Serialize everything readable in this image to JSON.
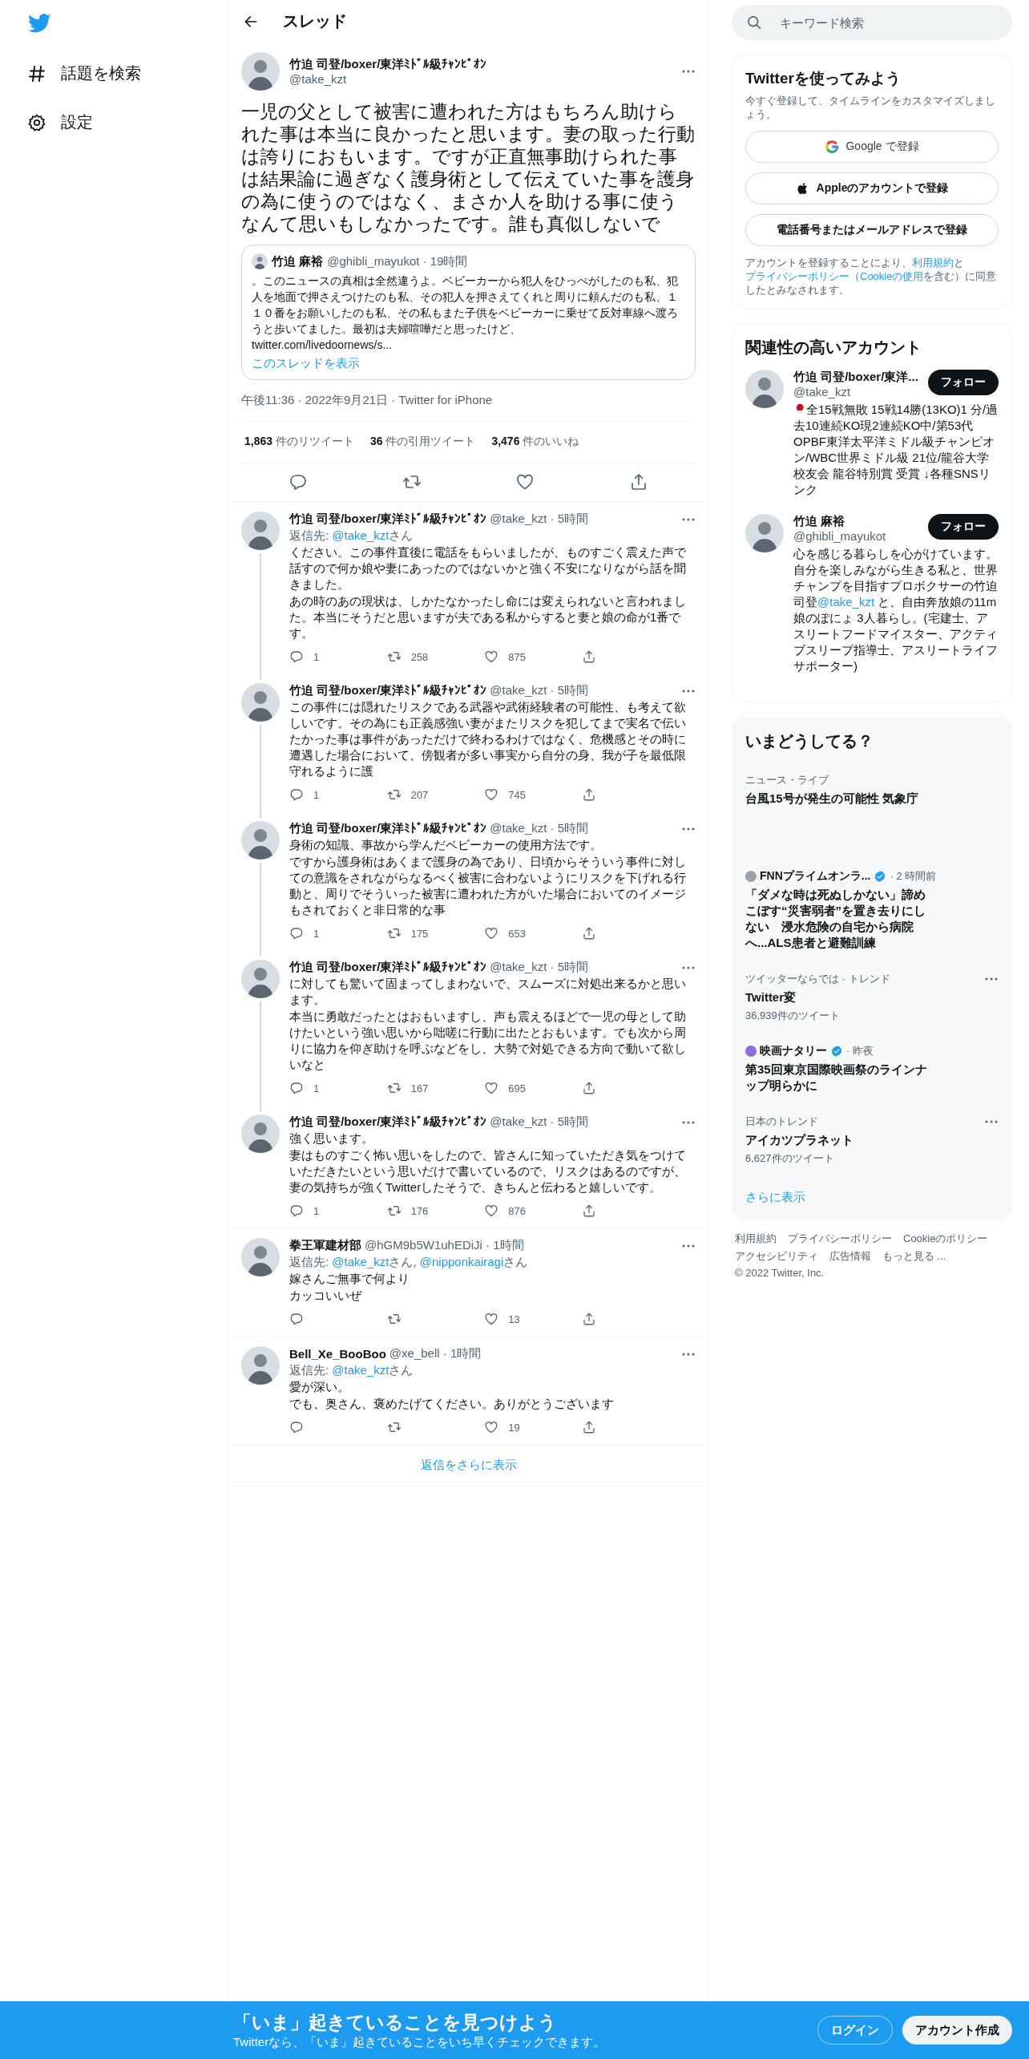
{
  "nav": [
    {
      "kind": "hashtag",
      "label": "話題を検索"
    },
    {
      "kind": "gear",
      "label": "設定"
    }
  ],
  "header": {
    "title": "スレッド"
  },
  "main_tweet": {
    "name": "竹迫 司登/boxer/東洋ﾐﾄﾞﾙ級ﾁｬﾝﾋﾟｵﾝ",
    "handle": "@take_kzt",
    "text": "一児の父として被害に遭われた方はもちろん助けられた事は本当に良かったと思います。妻の取った行動は誇りにおもいます。ですが正直無事助けられた事は結果論に過ぎなく護身術として伝えていた事を護身の為に使うのではなく、まさか人を助ける事に使うなんて思いもしなかったです。誰も真似しないで",
    "quote": {
      "name": "竹迫 麻裕",
      "meta": "@ghibli_mayukot · 19時間",
      "text": "。このニュースの真相は全然違うよ。ベビーカーから犯人をひっぺがしたのも私、犯人を地面で押さえつけたのも私、その犯人を押さえてくれと周りに頼んだのも私、１１０番をお願いしたのも私、その私もまた子供をベビーカーに乗せて反対車線へ渡ろうと歩いてました。最初は夫婦喧嘩だと思ったけど、\ntwitter.com/livedoornews/s...",
      "show_thread": "このスレッドを表示"
    },
    "timestamp": "午後11:36 · 2022年9月21日 · Twitter for iPhone",
    "stats": [
      {
        "count": "1,863",
        "label": "件のリツイート"
      },
      {
        "count": "36",
        "label": "件の引用ツイート"
      },
      {
        "count": "3,476",
        "label": "件のいいね"
      }
    ]
  },
  "replies": [
    {
      "name": "竹迫 司登/boxer/東洋ﾐﾄﾞﾙ級ﾁｬﾝﾋﾟｵﾝ",
      "meta": "@take_kzt · 5時間",
      "reply_to": {
        "label": "返信先:",
        "mentions": [
          {
            "handle": "@take_kzt",
            "suffix": "さん"
          }
        ]
      },
      "text": [
        "ください。この事件直後に電話をもらいましたが、ものすごく震えた声で話すので何か娘や妻にあったのではないかと強く不安になりながら話を聞きました。",
        "あの時のあの現状は、しかたなかったし命には変えられないと言われました。本当にそうだと思いますが夫である私からすると妻と娘の命が1番です。"
      ],
      "replies": "1",
      "retweets": "258",
      "likes": "875",
      "thread_continues": true
    },
    {
      "name": "竹迫 司登/boxer/東洋ﾐﾄﾞﾙ級ﾁｬﾝﾋﾟｵﾝ",
      "meta": "@take_kzt · 5時間",
      "text": [
        "この事件には隠れたリスクである武器や武術経験者の可能性、も考えて欲しいです。その為にも正義感強い妻がまたリスクを犯してまで実名で伝いたかった事は事件があっただけで終わるわけではなく、危機感とその時に遭遇した場合において、傍観者が多い事実から自分の身、我が子を最低限守れるように護"
      ],
      "replies": "1",
      "retweets": "207",
      "likes": "745",
      "thread_continues": true
    },
    {
      "name": "竹迫 司登/boxer/東洋ﾐﾄﾞﾙ級ﾁｬﾝﾋﾟｵﾝ",
      "meta": "@take_kzt · 5時間",
      "text": [
        "身術の知識、事故から学んだベビーカーの使用方法です。",
        "ですから護身術はあくまで護身の為であり、日頃からそういう事件に対しての意識をされながらなるべく被害に合わないようにリスクを下げれる行動と、周りでそういった被害に遭われた方がいた場合においてのイメージもされておくと非日常的な事"
      ],
      "replies": "1",
      "retweets": "175",
      "likes": "653",
      "thread_continues": true
    },
    {
      "name": "竹迫 司登/boxer/東洋ﾐﾄﾞﾙ級ﾁｬﾝﾋﾟｵﾝ",
      "meta": "@take_kzt · 5時間",
      "text": [
        "に対しても驚いて固まってしまわないで、スムーズに対処出来るかと思います。",
        "本当に勇敢だったとはおもいますし、声も震えるほどで一児の母として助けたいという強い思いから咄嗟に行動に出たとおもいます。でも次から周りに協力を仰ぎ助けを呼ぶなどをし、大勢で対処できる方向で動いて欲しいなと"
      ],
      "replies": "1",
      "retweets": "167",
      "likes": "695",
      "thread_continues": true
    },
    {
      "name": "竹迫 司登/boxer/東洋ﾐﾄﾞﾙ級ﾁｬﾝﾋﾟｵﾝ",
      "meta": "@take_kzt · 5時間",
      "text": [
        "強く思います。",
        "妻はものすごく怖い思いをしたので、皆さんに知っていただき気をつけていただきたいという思いだけで書いているので、リスクはあるのですが、妻の気持ちが強くTwitterしたそうで、きちんと伝わると嬉しいです。"
      ],
      "replies": "1",
      "retweets": "176",
      "likes": "876",
      "thread_continues": false
    },
    {
      "name": "拳王軍建材部",
      "meta": "@hGM9b5W1uhEDiJi · 1時間",
      "reply_to": {
        "label": "返信先:",
        "mentions": [
          {
            "handle": "@take_kzt",
            "suffix": "さん,"
          },
          {
            "handle": "@nipponkairagi",
            "suffix": "さん"
          }
        ]
      },
      "text": [
        "嫁さんご無事で何より",
        "カッコいいぜ"
      ],
      "likes": "13",
      "thread_continues": false
    },
    {
      "name": "Bell_Xe_BooBoo",
      "meta": "@xe_bell · 1時間",
      "reply_to": {
        "label": "返信先:",
        "mentions": [
          {
            "handle": "@take_kzt",
            "suffix": "さん"
          }
        ]
      },
      "text": [
        "愛が深い。",
        "でも、奥さん、褒めたげてください。ありがとうございます"
      ],
      "likes": "19",
      "thread_continues": false
    }
  ],
  "show_more_replies": "返信をさらに表示",
  "search": {
    "placeholder": "キーワード検索"
  },
  "signup": {
    "title": "Twitterを使ってみよう",
    "subtitle": "今すぐ登録して、タイムラインをカスタマイズしましょう。",
    "buttons": [
      {
        "kind": "google",
        "label": "Google で登録"
      },
      {
        "kind": "apple",
        "label": "Appleのアカウントで登録"
      },
      {
        "kind": "plain",
        "label": "電話番号またはメールアドレスで登録"
      }
    ],
    "legal": [
      {
        "kind": "text",
        "text": "アカウントを登録することにより、"
      },
      {
        "kind": "link",
        "text": "利用規約"
      },
      {
        "kind": "text",
        "text": "と"
      },
      {
        "kind": "link",
        "text": "プライバシーポリシー"
      },
      {
        "kind": "text",
        "text": "（"
      },
      {
        "kind": "link",
        "text": "Cookieの使用"
      },
      {
        "kind": "text",
        "text": "を含む）に同意したとみなされます。"
      }
    ]
  },
  "related": {
    "title": "関連性の高いアカウント",
    "accounts": [
      {
        "name": "竹迫 司登/boxer/東洋...",
        "handle": "@take_kzt",
        "follow": "フォロー",
        "bio": [
          {
            "kind": "glove"
          },
          {
            "kind": "text",
            "text": "全15戦無敗 15戦14勝(13KO)1 分/過去10連続KO現2連続KO中/第53代OPBF東洋太平洋ミドル級チャンピオン/WBC世界ミドル級 21位/龍谷大学校友会 龍谷特別賞 受賞 ↓各種SNSリンク"
          }
        ]
      },
      {
        "name": "竹迫 麻裕",
        "handle": "@ghibli_mayukot",
        "follow": "フォロー",
        "bio": [
          {
            "kind": "text",
            "text": "心を感じる暮らしを心がけています。自分を楽しみながら生きる私と、世界チャンプを目指すプロボクサーの竹迫司登"
          },
          {
            "kind": "link",
            "text": "@take_kzt"
          },
          {
            "kind": "text",
            "text": " と、自由奔放娘の11m娘のぽにょ 3人暮らし。(宅建士、アスリートフードマイスター、アクティブスリープ指導士、アスリートライフサポーター)"
          }
        ]
      }
    ]
  },
  "trends": {
    "title": "いまどうしてる？",
    "items": [
      {
        "kind": "trend",
        "category": "ニュース・ライブ",
        "title": "台風15号が発生の可能性 気象庁",
        "more": false
      },
      {
        "kind": "news",
        "source": "FNNプライムオンラ...",
        "color": "#9aa3ab",
        "verified": true,
        "time": "· 2 時間前",
        "title": "「ダメな時は死ぬしかない」諦めこぼす“災害弱者”を置き去りにしない　浸水危険の自宅から病院へ...ALS患者と避難訓練"
      },
      {
        "kind": "trend",
        "category": "ツイッターならでは · トレンド",
        "title": "Twitter変",
        "count": "36,939件のツイート",
        "more": true
      },
      {
        "kind": "news",
        "source": "映画ナタリー",
        "color": "#8a6fd8",
        "verified": true,
        "time": "· 昨夜",
        "title": "第35回東京国際映画祭のラインナップ明らかに"
      },
      {
        "kind": "trend",
        "category": "日本のトレンド",
        "title": "アイカツプラネット",
        "count": "6,627件のツイート",
        "more": true
      }
    ],
    "show_more": "さらに表示"
  },
  "footer": [
    "利用規約",
    "プライバシーポリシー",
    "Cookieのポリシー",
    "アクセシビリティ",
    "広告情報",
    "もっと見る ...",
    "© 2022 Twitter, Inc."
  ],
  "bottom_bar": {
    "title": "「いま」起きていることを見つけよう",
    "subtitle": "Twitterなら、「いま」起きていることをいち早くチェックできます。",
    "buttons": [
      {
        "kind": "outline",
        "label": "ログイン"
      },
      {
        "kind": "filled",
        "label": "アカウント作成"
      }
    ]
  }
}
